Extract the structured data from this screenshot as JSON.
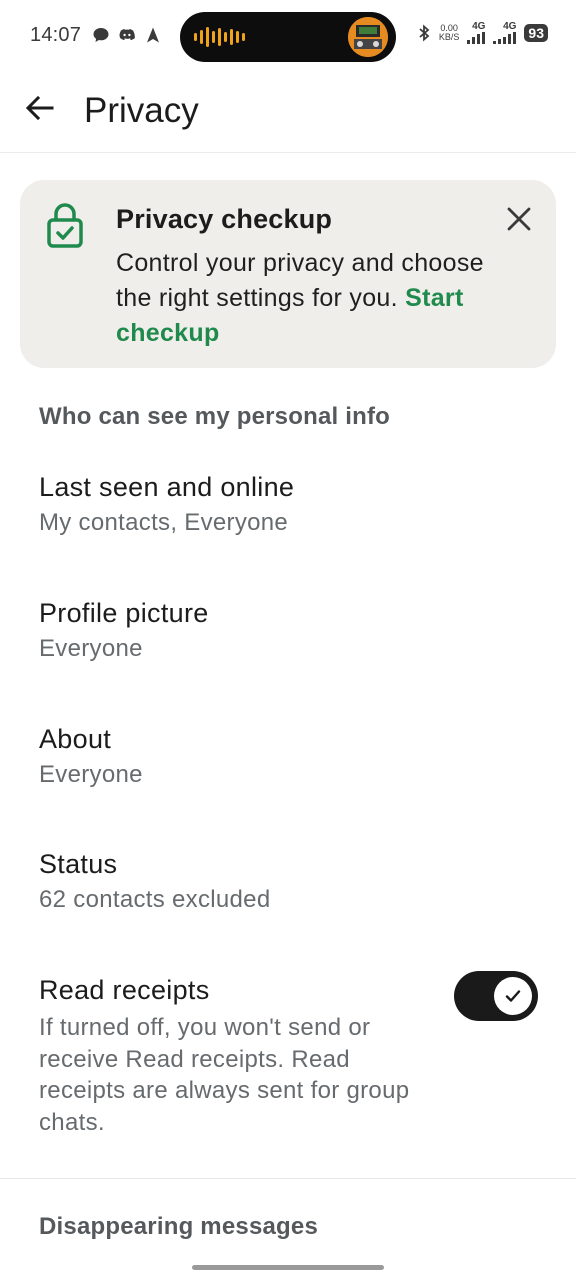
{
  "status_bar": {
    "time": "14:07",
    "left_icons": [
      "chat-bubble-icon",
      "discord-icon",
      "navigation-arrow-icon"
    ],
    "net_speed": "0.00",
    "net_unit": "KB/S",
    "sim1_label": "4G",
    "sim2_label": "4G",
    "battery": "93",
    "accent_color": "#f0a21a"
  },
  "appbar": {
    "title": "Privacy",
    "back_icon": "arrow-left-icon"
  },
  "checkup_card": {
    "title": "Privacy checkup",
    "body": "Control your privacy and choose the right settings for you.",
    "link": "Start checkup",
    "link_color": "#1f8a4c",
    "icon": "lock-check-icon",
    "close_icon": "close-icon"
  },
  "personal_info": {
    "header": "Who can see my personal info",
    "items": [
      {
        "title": "Last seen and online",
        "value": "My contacts, Everyone"
      },
      {
        "title": "Profile picture",
        "value": "Everyone"
      },
      {
        "title": "About",
        "value": "Everyone"
      },
      {
        "title": "Status",
        "value": "62 contacts excluded"
      }
    ]
  },
  "read_receipts": {
    "title": "Read receipts",
    "description": "If turned off, you won't send or receive Read receipts. Read receipts are always sent for group chats.",
    "enabled": true
  },
  "disappearing": {
    "header": "Disappearing messages"
  }
}
